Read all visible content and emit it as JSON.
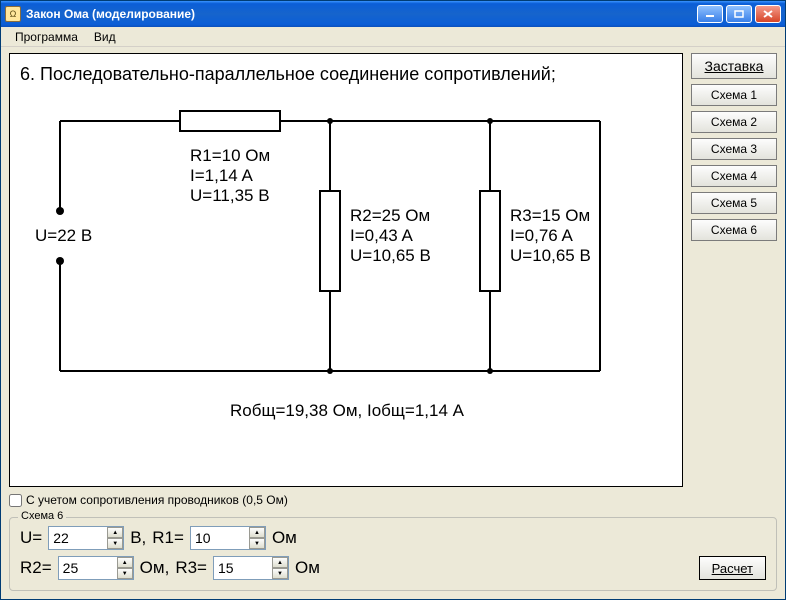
{
  "window": {
    "title": "Закон Ома (моделирование)"
  },
  "menu": {
    "program": "Программа",
    "view": "Вид"
  },
  "sidebar": {
    "splash": "Заставка",
    "items": [
      {
        "label": "Схема 1"
      },
      {
        "label": "Схема 2"
      },
      {
        "label": "Схема 3"
      },
      {
        "label": "Схема 4"
      },
      {
        "label": "Схема 5"
      },
      {
        "label": "Схема 6"
      }
    ]
  },
  "circuit": {
    "title": "6. Последовательно-параллельное соединение сопротивлений;",
    "U_src": "U=22 В",
    "R1": {
      "l1": "R1=10 Ом",
      "l2": "I=1,14 A",
      "l3": "U=11,35 В"
    },
    "R2": {
      "l1": "R2=25 Ом",
      "l2": "I=0,43 A",
      "l3": "U=10,65 В"
    },
    "R3": {
      "l1": "R3=15 Ом",
      "l2": "I=0,76 A",
      "l3": "U=10,65 В"
    },
    "totals": "Rобщ=19,38 Ом, Iобщ=1,14 А"
  },
  "checkbox": {
    "label": "С учетом сопротивления проводников (0,5 Ом)"
  },
  "inputs": {
    "group_label": "Схема 6",
    "U_label": "U=",
    "U_val": "22",
    "U_unit": "В,",
    "R1_label": "R1=",
    "R1_val": "10",
    "R1_unit": "Ом",
    "R2_label": "R2=",
    "R2_val": "25",
    "R2_unit": "Ом,",
    "R3_label": "R3=",
    "R3_val": "15",
    "R3_unit": "Ом",
    "calc": "Расчет"
  }
}
